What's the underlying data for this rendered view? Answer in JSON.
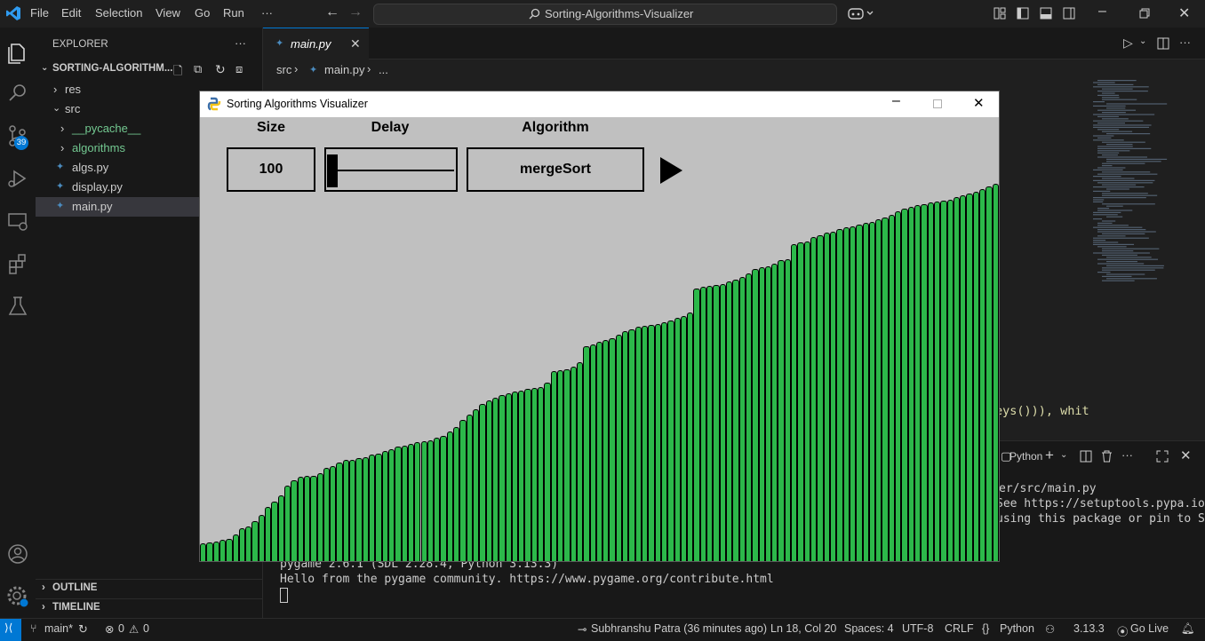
{
  "menu": {
    "file": "File",
    "edit": "Edit",
    "selection": "Selection",
    "view": "View",
    "go": "Go",
    "run": "Run",
    "more": "···"
  },
  "search": {
    "label": "Sorting-Algorithms-Visualizer"
  },
  "sidebar": {
    "title": "EXPLORER",
    "more": "···",
    "root": "SORTING-ALGORITHM...",
    "items": [
      {
        "label": "res",
        "type": "folder"
      },
      {
        "label": "src",
        "type": "folder-open"
      },
      {
        "label": "__pycache__",
        "type": "folder"
      },
      {
        "label": "algorithms",
        "type": "folder"
      },
      {
        "label": "algs.py",
        "type": "file"
      },
      {
        "label": "display.py",
        "type": "file"
      },
      {
        "label": "main.py",
        "type": "file"
      }
    ],
    "outline": "OUTLINE",
    "timeline": "TIMELINE"
  },
  "activity": {
    "badge": "39"
  },
  "editor": {
    "tab": "main.py",
    "breadcrumb_src": "src",
    "breadcrumb_file": "main.py",
    "breadcrumb_more": "...",
    "code_fragment": "eys())), whit"
  },
  "terminal": {
    "profile": "Python",
    "lines": [
      "er/src/main.py",
      "See https://setuptools.pypa.io/",
      "using this package or pin to Se",
      "pygame 2.6.1 (SDL 2.28.4, Python 3.13.3)",
      "Hello from the pygame community. https://www.pygame.org/contribute.html"
    ]
  },
  "pygame": {
    "title": "Sorting Algorithms Visualizer",
    "headers": {
      "size": "Size",
      "delay": "Delay",
      "algorithm": "Algorithm"
    },
    "size_value": "100",
    "algorithm_value": "mergeSort",
    "delay_level": 0.0,
    "bar_color": "#2cb84a",
    "bg_color": "#c0c0c0"
  },
  "chart_data": {
    "type": "bar",
    "values": [
      16,
      17,
      18,
      19,
      20,
      24,
      30,
      31,
      36,
      42,
      49,
      54,
      59,
      68,
      73,
      76,
      77,
      77,
      79,
      84,
      86,
      89,
      91,
      91,
      93,
      94,
      96,
      97,
      99,
      101,
      103,
      104,
      106,
      107,
      108,
      109,
      111,
      113,
      117,
      121,
      127,
      132,
      137,
      142,
      145,
      147,
      150,
      151,
      153,
      154,
      155,
      156,
      157,
      161,
      171,
      172,
      173,
      175,
      179,
      194,
      195,
      198,
      199,
      201,
      204,
      207,
      209,
      211,
      212,
      213,
      214,
      215,
      217,
      219,
      221,
      224,
      246,
      247,
      248,
      249,
      250,
      252,
      254,
      256,
      259,
      263,
      265,
      266,
      268,
      271,
      272,
      286,
      287,
      288,
      292,
      294,
      296,
      297,
      299,
      301,
      302,
      303,
      305,
      306,
      308,
      310,
      312,
      315,
      318,
      319,
      321,
      322,
      323,
      324,
      325,
      326,
      328,
      330,
      331,
      333,
      335,
      338,
      340
    ],
    "ylim": [
      0,
      400
    ]
  },
  "status": {
    "branch": "main*",
    "errors": "0",
    "warnings": "0",
    "author": "Subhranshu Patra (36 minutes ago)",
    "position": "Ln 18, Col 20",
    "spaces": "Spaces: 4",
    "encoding": "UTF-8",
    "eol": "CRLF",
    "language": "Python",
    "version": "3.13.3",
    "golive": "Go Live"
  }
}
